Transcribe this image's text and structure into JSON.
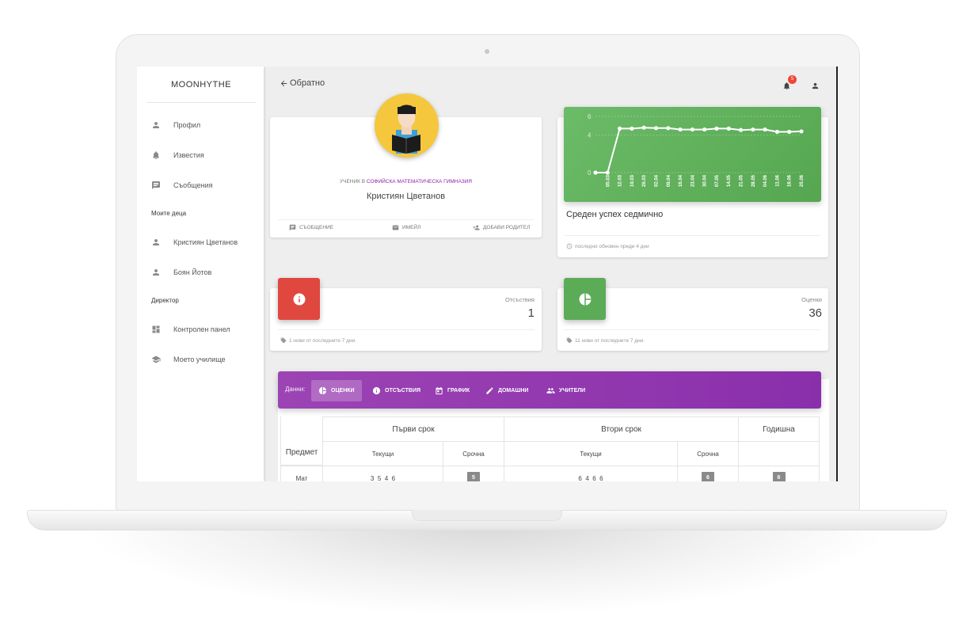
{
  "sidebar": {
    "brand": "MOONHYTHE",
    "items": [
      {
        "label": "Профил",
        "icon": "person-icon"
      },
      {
        "label": "Известия",
        "icon": "bell-icon"
      },
      {
        "label": "Съобщения",
        "icon": "chat-icon"
      }
    ],
    "children_title": "Моите деца",
    "children": [
      {
        "label": "Кристиян Цветанов",
        "icon": "person-icon"
      },
      {
        "label": "Боян Йотов",
        "icon": "person-icon"
      }
    ],
    "director_title": "Директор",
    "director_items": [
      {
        "label": "Контролен панел",
        "icon": "dashboard-icon"
      },
      {
        "label": "Моето училище",
        "icon": "school-icon"
      }
    ]
  },
  "header": {
    "back_label": "Обратно",
    "notification_count": "5"
  },
  "profile": {
    "prefix": "УЧЕНИК В",
    "school": "СОФИЙСКА МАТЕМАТИЧЕСКА ГИМНАЗИЯ",
    "name": "Кристиян Цветанов",
    "actions": {
      "message": "СЪОБЩЕНИЕ",
      "email": "ИМЕЙЛ",
      "add_parent": "ДОБАВИ РОДИТЕЛ"
    }
  },
  "chart_card": {
    "title": "Среден успех седмично",
    "footer": "последно обновен преди 4 дни"
  },
  "chart_data": {
    "type": "line",
    "x": [
      "05.03",
      "12.03",
      "19.03",
      "26.03",
      "02.04",
      "09.04",
      "16.04",
      "23.04",
      "30.04",
      "07.05",
      "14.05",
      "21.05",
      "28.05",
      "04.06",
      "11.06",
      "18.06",
      "25.06"
    ],
    "series": [
      {
        "values": [
          0,
          0,
          4.7,
          4.7,
          4.8,
          4.75,
          4.75,
          4.6,
          4.6,
          4.6,
          4.7,
          4.7,
          4.55,
          4.6,
          4.6,
          4.35,
          4.35,
          4.4
        ]
      }
    ],
    "x_labels_shown": [
      "05.03",
      "12.03",
      "19.03",
      "26.03",
      "02.04",
      "09.04",
      "16.04",
      "23.04",
      "30.04",
      "07.05",
      "14.05",
      "21.05",
      "28.05",
      "04.06",
      "11.06",
      "18.06",
      "25.06"
    ],
    "yticks": [
      0,
      4,
      6
    ],
    "ylim": [
      0,
      6
    ],
    "grid": true,
    "line_color": "#ffffff"
  },
  "stats": {
    "absences": {
      "label": "Отсъствия",
      "value": "1",
      "footer": "1 нови от последните 7 дни.",
      "color": "#e0483f",
      "icon": "info-icon"
    },
    "grades": {
      "label": "Оценки",
      "value": "36",
      "footer": "11 нови от последните 7 дни.",
      "color": "#5cab57",
      "icon": "pie-chart-icon"
    }
  },
  "tabs": {
    "lead": "Данни:",
    "items": [
      {
        "label": "ОЦЕНКИ",
        "icon": "pie-chart-icon",
        "active": true
      },
      {
        "label": "ОТСЪСТВИЯ",
        "icon": "info-icon",
        "active": false
      },
      {
        "label": "ГРАФИК",
        "icon": "calendar-icon",
        "active": false
      },
      {
        "label": "ДОМАШНИ",
        "icon": "pencil-icon",
        "active": false
      },
      {
        "label": "УЧИТЕЛИ",
        "icon": "people-icon",
        "active": false
      }
    ],
    "color": "#9232b0"
  },
  "grades_table": {
    "term1": "Първи срок",
    "term2": "Втори срок",
    "annual": "Годишна",
    "subject_header": "Предмет",
    "current": "Текущи",
    "term_grade": "Срочна",
    "rows": [
      {
        "subject": "Мат",
        "t1_current": "3  5  4  6",
        "t1_term": "5",
        "t2_current": "6  4  6  6",
        "t2_term": "6",
        "annual": "6"
      }
    ]
  }
}
